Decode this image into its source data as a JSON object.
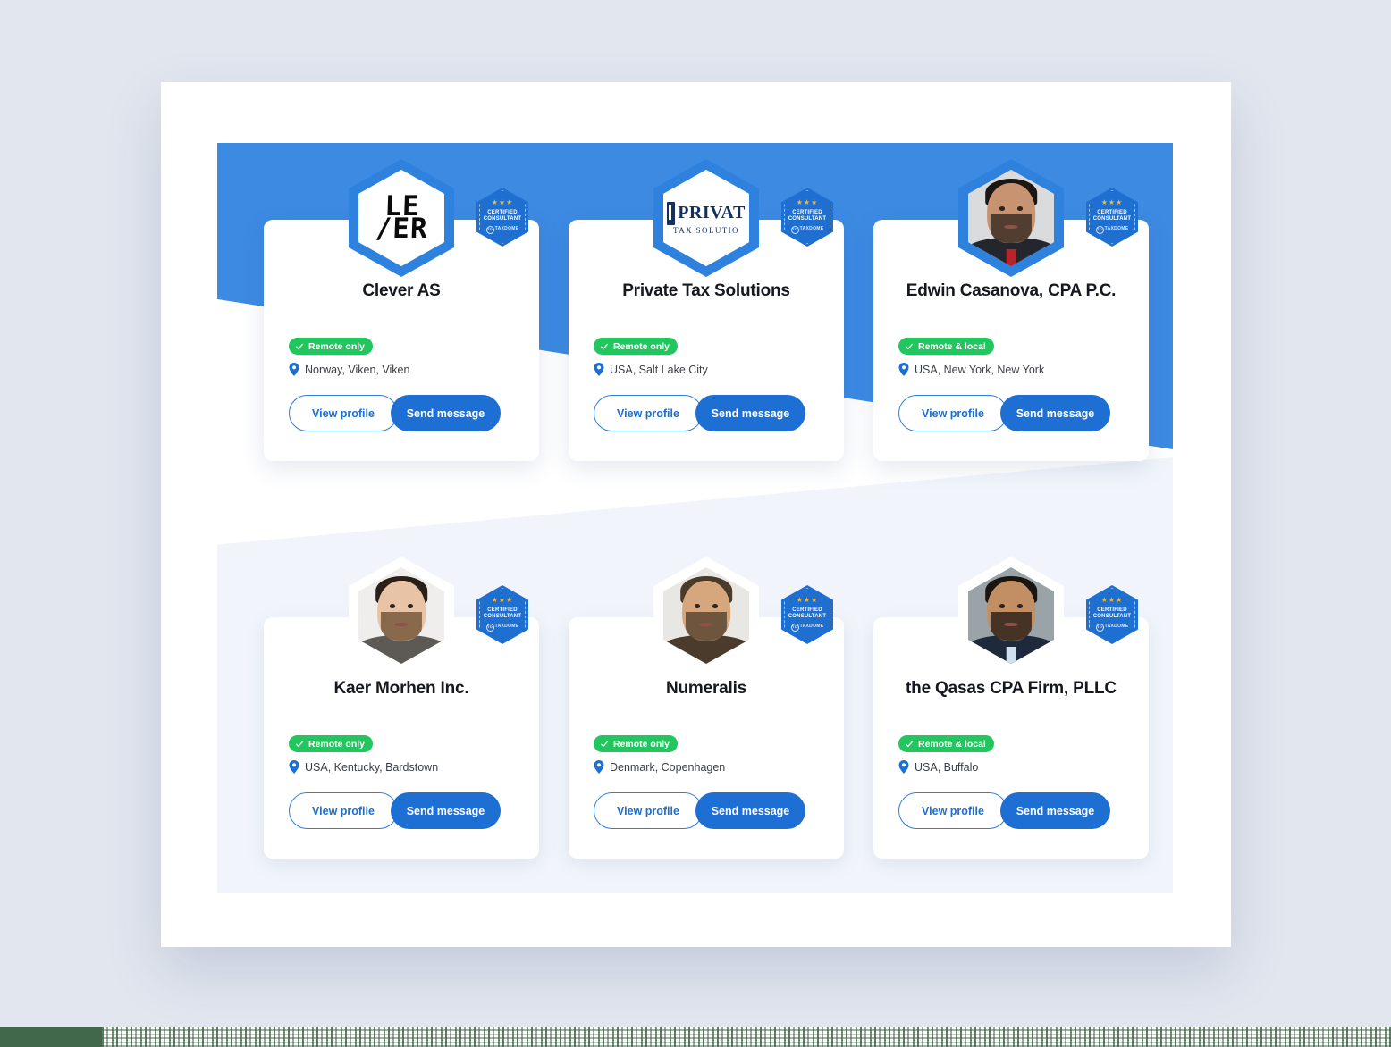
{
  "theme": {
    "page_background": "#e2e6ef",
    "sheet_background": "#ffffff",
    "banner_blue": "#3d8ae3",
    "panel_light": "#f1f5fb",
    "accent_blue": "#1d6fd4",
    "status_green": "#22c55e",
    "badge_blue": "#1f6fd0",
    "star_gold": "#f5b93a",
    "strip_green": "#41684a"
  },
  "badge": {
    "stars": "★★★",
    "line1": "CERTIFIED",
    "line2": "CONSULTANT",
    "brand_mark": "TD",
    "brand_name": "TAXDOME"
  },
  "actions": {
    "view_profile_label": "View profile",
    "send_message_label": "Send message"
  },
  "cards": [
    {
      "name": "Clever AS",
      "status": "Remote only",
      "location": "Norway, Viken, Viken",
      "avatar_kind": "logo-clever",
      "logo_line1": "LE",
      "logo_line2": "/ER",
      "ringed": true
    },
    {
      "name": "Private Tax Solutions",
      "status": "Remote only",
      "location": "USA, Salt Lake City",
      "avatar_kind": "logo-privat",
      "logo_word": "PRIVAT",
      "logo_sub": "TAX SOLUTIO",
      "ringed": true
    },
    {
      "name": "Edwin Casanova, CPA P.C.",
      "status": "Remote & local",
      "location": "USA, New York, New York",
      "avatar_kind": "photo",
      "ringed": true,
      "photo": {
        "bg": "#d9dbdc",
        "skin": "#c79371",
        "hair": "#1d1713",
        "body": "#23262c",
        "beard": "#2a211b",
        "tie": "#b8242c"
      }
    },
    {
      "name": "Kaer Morhen Inc.",
      "status": "Remote only",
      "location": "USA, Kentucky, Bardstown",
      "avatar_kind": "photo",
      "ringed": false,
      "photo": {
        "bg": "#f0eeec",
        "skin": "#e8c3a6",
        "hair": "#2b2017",
        "body": "#5d5a56",
        "beard": "#6a4b2e",
        "tie": ""
      }
    },
    {
      "name": "Numeralis",
      "status": "Remote only",
      "location": "Denmark, Copenhagen",
      "avatar_kind": "photo",
      "ringed": false,
      "photo": {
        "bg": "#e9e7e4",
        "skin": "#d6a77d",
        "hair": "#4a3a2a",
        "body": "#4b3b2c",
        "beard": "#4a3a2a",
        "tie": ""
      }
    },
    {
      "name": "the Qasas CPA Firm, PLLC",
      "status": "Remote & local",
      "location": "USA, Buffalo",
      "avatar_kind": "photo",
      "ringed": false,
      "photo": {
        "bg": "#9aa3a8",
        "skin": "#c28f65",
        "hair": "#1b1511",
        "body": "#1e2a3c",
        "beard": "#1b1511",
        "tie": "#cfe0ee"
      }
    }
  ]
}
